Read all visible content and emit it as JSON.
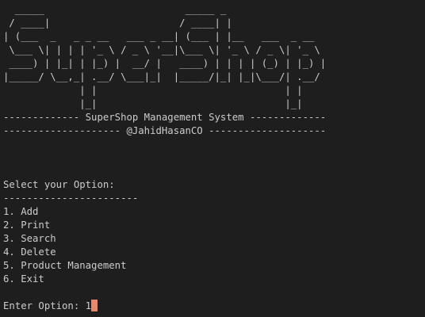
{
  "ascii_banner": [
    "  _____                        _____ _",
    " / ____|                      / ____| |",
    "| (___  _   _ _ __   ___ _ __| (___ | |__   ___  _ __",
    " \\___ \\| | | | '_ \\ / _ \\ '__|\\___ \\| '_ \\ / _ \\| '_ \\",
    " ____) | |_| | |_) |  __/ |   ____) | | | | (_) | |_) |",
    "|_____/ \\__,_| .__/ \\___|_|  |_____/|_| |_|\\___/| .__/",
    "             | |                                | |",
    "             |_|                                |_|"
  ],
  "title_line": "------------- SuperShop Management System -------------",
  "author_line": "-------------------- @JahidHasanCO --------------------",
  "menu": {
    "prompt": "Select your Option:",
    "divider": "-----------------------",
    "options": [
      "1. Add",
      "2. Print",
      "3. Search",
      "4. Delete",
      "5. Product Management",
      "6. Exit"
    ]
  },
  "input": {
    "label": "Enter Option: ",
    "value": "1"
  },
  "colors": {
    "background": "#1e1e1e",
    "text": "#cccccc",
    "cursor": "#e8896b"
  }
}
